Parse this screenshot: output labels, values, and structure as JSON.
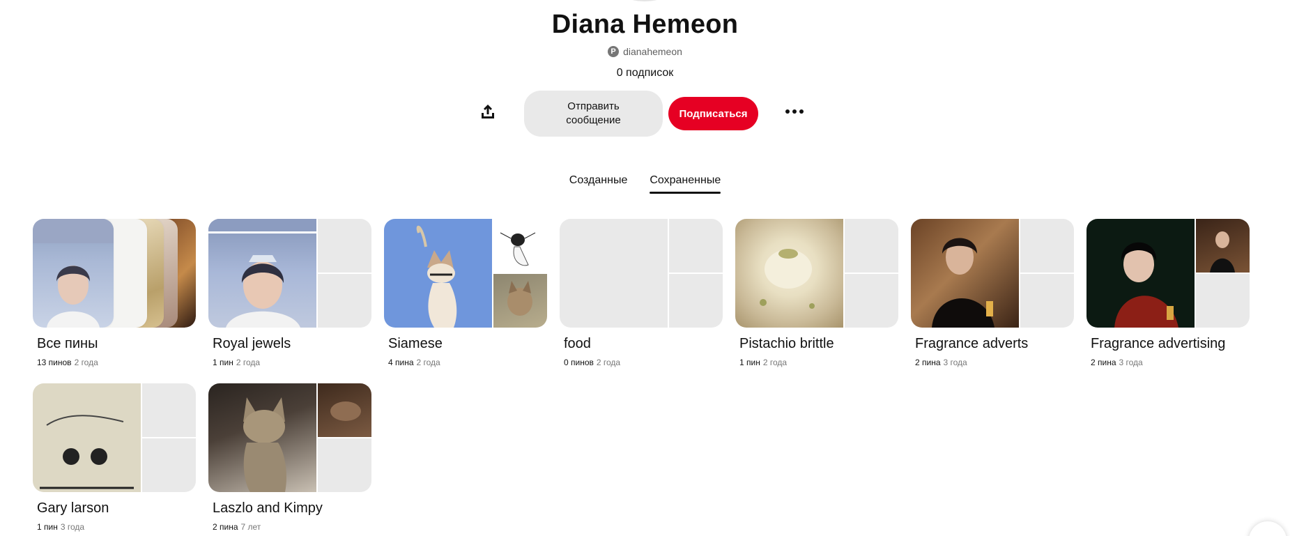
{
  "profile": {
    "name": "Diana Hemeon",
    "username": "dianahemeon",
    "following": "0 подписок"
  },
  "actions": {
    "message_label": "Отправить сообщение",
    "follow_label": "Подписаться"
  },
  "tabs": [
    {
      "label": "Созданные",
      "active": false
    },
    {
      "label": "Сохраненные",
      "active": true
    }
  ],
  "boards": [
    {
      "title": "Все пины",
      "pins": "13 пинов",
      "age": "2 года"
    },
    {
      "title": "Royal jewels",
      "pins": "1 пин",
      "age": "2 года"
    },
    {
      "title": "Siamese",
      "pins": "4 пина",
      "age": "2 года"
    },
    {
      "title": "food",
      "pins": "0 пинов",
      "age": "2 года"
    },
    {
      "title": "Pistachio brittle",
      "pins": "1 пин",
      "age": "2 года"
    },
    {
      "title": "Fragrance adverts",
      "pins": "2 пина",
      "age": "3 года"
    },
    {
      "title": "Fragrance advertising",
      "pins": "2 пина",
      "age": "3 года"
    },
    {
      "title": "Gary larson",
      "pins": "1 пин",
      "age": "3 года"
    },
    {
      "title": "Laszlo and Kimpy",
      "pins": "2 пина",
      "age": "7 лет"
    }
  ],
  "colors": {
    "accent": "#e60023",
    "button_gray": "#e9e9e9",
    "placeholder": "#e9e9e9"
  },
  "icons": [
    "pinterest-icon",
    "share-icon",
    "more-icon"
  ]
}
